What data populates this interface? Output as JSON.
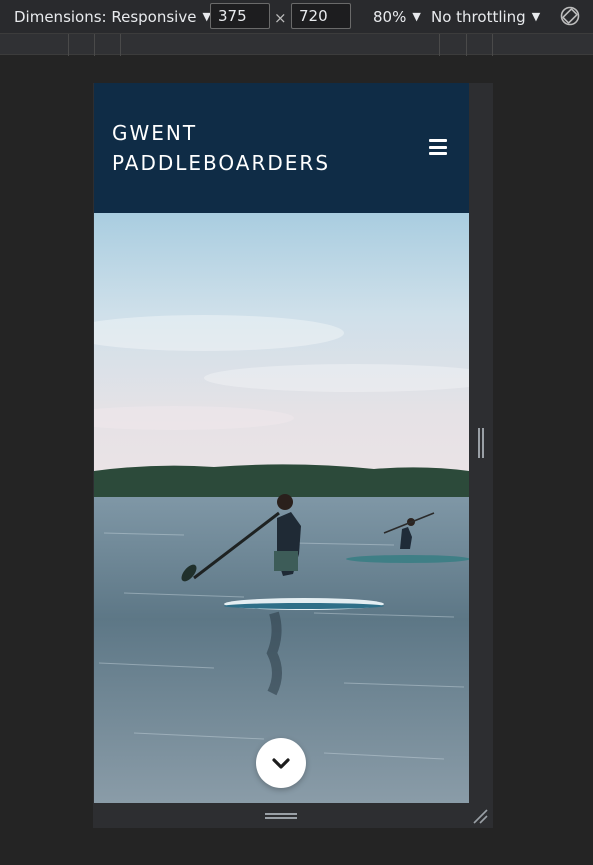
{
  "devtools": {
    "dimensions_label": "Dimensions: Responsive",
    "width_value": "375",
    "height_value": "720",
    "times_symbol": "×",
    "zoom_label": "80%",
    "throttling_label": "No throttling",
    "dropdown_arrow": "▼"
  },
  "site": {
    "brand_line1": "GWENT",
    "brand_line2": "PADDLEBOARDERS",
    "header_color": "#0f2c46"
  },
  "icons": {
    "menu": "hamburger-icon",
    "scroll": "chevron-down-icon",
    "rotate": "rotate-icon"
  }
}
